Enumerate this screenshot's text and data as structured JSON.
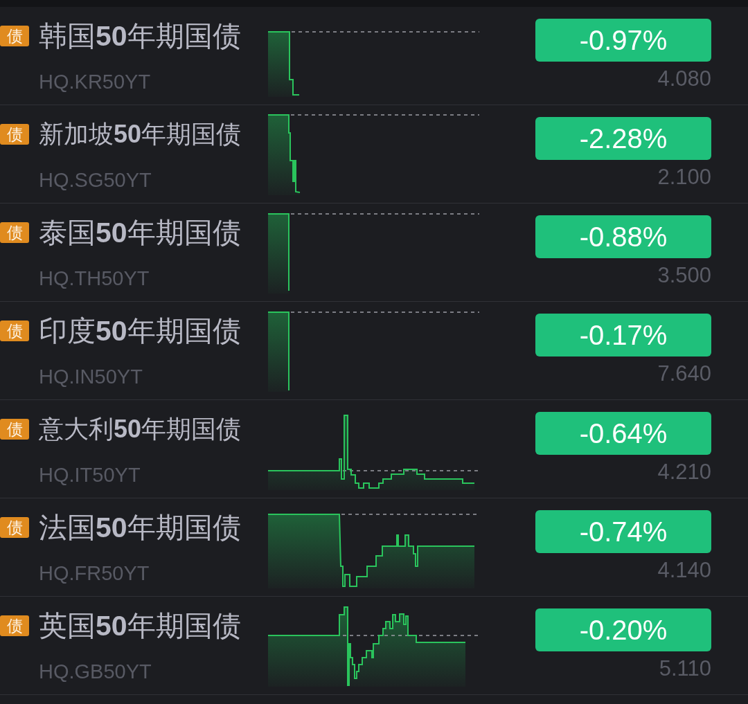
{
  "rows": [
    {
      "badge": "债",
      "name": "韩国**50**年期国债",
      "code": "HQ.KR50YT",
      "change": "-0.97%",
      "price": "4.080"
    },
    {
      "badge": "债",
      "name": "新加坡**50**年期国债",
      "code": "HQ.SG50YT",
      "change": "-2.28%",
      "price": "2.100"
    },
    {
      "badge": "债",
      "name": "泰国**50**年期国债",
      "code": "HQ.TH50YT",
      "change": "-0.88%",
      "price": "3.500"
    },
    {
      "badge": "债",
      "name": "印度**50**年期国债",
      "code": "HQ.IN50YT",
      "change": "-0.17%",
      "price": "7.640"
    },
    {
      "badge": "债",
      "name": "意大利**50**年期国债",
      "code": "HQ.IT50YT",
      "change": "-0.64%",
      "price": "4.210"
    },
    {
      "badge": "债",
      "name": "法国**50**年期国债",
      "code": "HQ.FR50YT",
      "change": "-0.74%",
      "price": "4.140"
    },
    {
      "badge": "债",
      "name": "英国**50**年期国债",
      "code": "HQ.GB50YT",
      "change": "-0.20%",
      "price": "5.110"
    }
  ]
}
